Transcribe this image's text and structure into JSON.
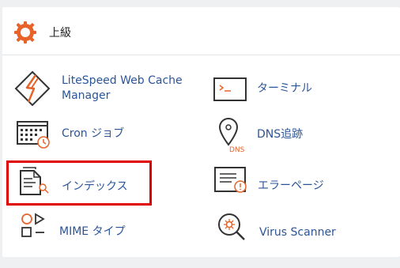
{
  "section": {
    "title": "上級",
    "icon": "gear-icon",
    "accent": "#e8632a"
  },
  "items": [
    {
      "label": "LiteSpeed Web Cache Manager",
      "line1": "LiteSpeed Web Cache",
      "line2": "Manager",
      "icon": "litespeed-icon"
    },
    {
      "label": "ターミナル",
      "icon": "terminal-icon"
    },
    {
      "label": "Cron ジョブ",
      "icon": "calendar-clock-icon"
    },
    {
      "label": "DNS追跡",
      "icon": "dns-pin-icon"
    },
    {
      "label": "インデックス",
      "icon": "document-search-icon"
    },
    {
      "label": "エラーページ",
      "icon": "error-page-icon"
    },
    {
      "label": "MIME タイプ",
      "icon": "mime-types-icon"
    },
    {
      "label": "Virus Scanner",
      "icon": "virus-scanner-icon"
    }
  ],
  "colors": {
    "link": "#2b5597",
    "icon_dark": "#333333",
    "icon_accent": "#e8632a",
    "highlight": "#e00000"
  }
}
